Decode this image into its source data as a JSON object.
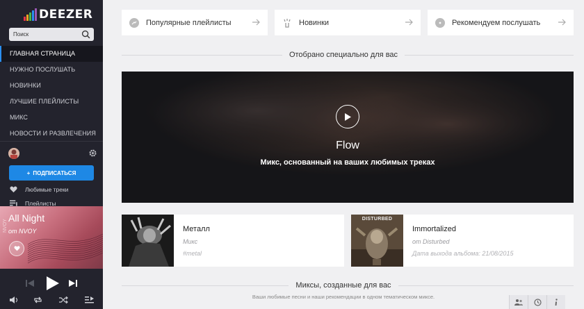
{
  "app": {
    "logo_text": "DEEZER",
    "logo_colors": [
      "#e6354b",
      "#f5a623",
      "#49b847",
      "#2b8ff0",
      "#9b59b6"
    ]
  },
  "search": {
    "placeholder": "Поиск"
  },
  "nav": {
    "items": [
      {
        "label": "ГЛАВНАЯ СТРАНИЦА",
        "active": true
      },
      {
        "label": "НУЖНО ПОСЛУШАТЬ"
      },
      {
        "label": "НОВИНКИ"
      },
      {
        "label": "ЛУЧШИЕ ПЛЕЙЛИСТЫ"
      },
      {
        "label": "МИКС"
      },
      {
        "label": "НОВОСТИ И РАЗВЛЕЧЕНИЯ"
      }
    ]
  },
  "subscribe": {
    "plus": "+",
    "label": "ПОДПИСАТЬСЯ"
  },
  "library": {
    "favorites": "Любимые треки",
    "playlists": "Плейлисты"
  },
  "player": {
    "title": "All Night",
    "artist": "от NVOY",
    "vertical_text": "NVOY"
  },
  "quick": [
    {
      "label": "Популярные плейлисты",
      "icon": "chart-icon"
    },
    {
      "label": "Новинки",
      "icon": "sparkle-icon"
    },
    {
      "label": "Рекомендуем послушать",
      "icon": "disc-icon"
    }
  ],
  "section1": {
    "title": "Отобрано специально для вас"
  },
  "hero": {
    "title": "Flow",
    "subtitle": "Микс, основанный на ваших любимых треках"
  },
  "tiles": [
    {
      "title": "Металл",
      "subtitle": "Микс",
      "meta": "#metal"
    },
    {
      "title": "Immortalized",
      "subtitle": "от Disturbed",
      "meta": "Дата выхода альбома: 21/08/2015",
      "art_text": "DISTURBED"
    }
  ],
  "section2": {
    "title": "Миксы, созданные для вас",
    "subtitle": "Ваши любимые песни и наши рекомендации в одном тематическом миксе."
  },
  "colors": {
    "accent": "#1e88e5",
    "sidebar": "#23232d"
  }
}
